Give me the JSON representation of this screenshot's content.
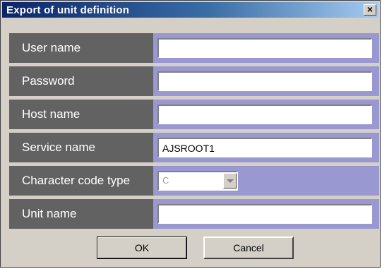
{
  "window": {
    "title": "Export of unit definition",
    "close_glyph": "×"
  },
  "fields": {
    "user_name": {
      "label": "User name",
      "value": ""
    },
    "password": {
      "label": "Password",
      "value": ""
    },
    "host_name": {
      "label": "Host name",
      "value": ""
    },
    "service_name": {
      "label": "Service name",
      "value": "AJSROOT1"
    },
    "character_code_type": {
      "label": "Character code type",
      "selected": "C",
      "disabled": true
    },
    "unit_name": {
      "label": "Unit name",
      "value": ""
    }
  },
  "buttons": {
    "ok_label": "OK",
    "cancel_label": "Cancel"
  },
  "colors": {
    "label_bg": "#626262",
    "row_bg": "#9a98d0",
    "dialog_bg": "#d4d0c8",
    "title_start": "#0a246a",
    "title_end": "#a6caf0"
  },
  "icons": {
    "close": "close-icon",
    "dropdown": "chevron-down-icon"
  }
}
